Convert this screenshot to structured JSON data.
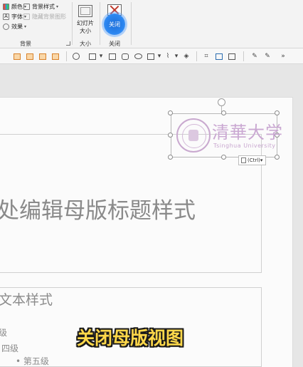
{
  "ribbon": {
    "background_group": {
      "color_label": "颜色",
      "background_style_label": "背景样式",
      "font_label": "字体",
      "hide_graphics_label": "隐藏背景图形",
      "effects_label": "效果",
      "group_label": "背景"
    },
    "size_group": {
      "slide_size_label": "幻灯片\n大小",
      "slide_size_line1": "幻灯片",
      "slide_size_line2": "大小",
      "group_label": "大小"
    },
    "close_group": {
      "close_button_label": "关闭",
      "highlight_label": "关闭",
      "group_label": "关闭"
    }
  },
  "icons": [
    "arrange-icon",
    "shape-icon",
    "line-icon",
    "rectangle-icon",
    "rounded-rectangle-icon",
    "oval-icon",
    "fill-icon",
    "outline-icon",
    "effects-icon",
    "crop-icon",
    "picture-icon",
    "eyedropper-icon"
  ],
  "slide": {
    "title_placeholder": "处编辑母版标题样式",
    "body_level1": "文本样式",
    "body_level3": "级",
    "body_level4": "四级",
    "body_level5": "第五级",
    "body_level5_bullet": "•"
  },
  "logo": {
    "chinese": "清華大学",
    "english": "Tsinghua University"
  },
  "paste_options": {
    "label": "(Ctrl)",
    "dropdown": "▾"
  },
  "caption": "关闭母版视图",
  "colors": {
    "caption_fill": "#ffd84a",
    "caption_outline": "#1a1a1a",
    "logo_purple": "#c9a9cf",
    "highlight_blue": "#2b86f0"
  }
}
